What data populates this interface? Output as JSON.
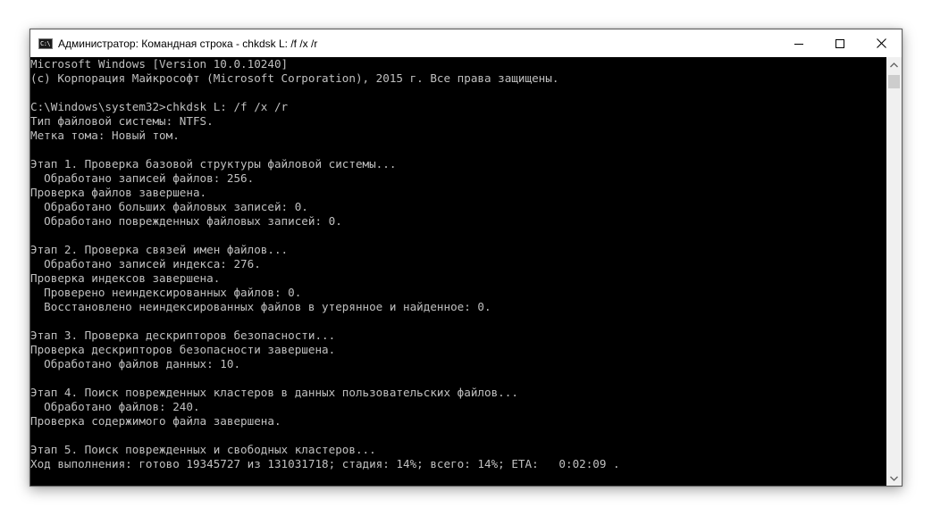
{
  "window": {
    "title": "Администратор: Командная строка - chkdsk  L: /f /x /r",
    "icon_label": "C:\\",
    "icons": {
      "app": "cmd-icon",
      "minimize": "minimize-icon",
      "maximize": "maximize-icon",
      "close": "close-icon",
      "scroll_up": "scroll-up-arrow-icon",
      "scroll_down": "scroll-down-arrow-icon"
    }
  },
  "console": {
    "text_color": "#c0c0c0",
    "background": "#000000",
    "lines": [
      "Microsoft Windows [Version 10.0.10240]",
      "(c) Корпорация Майкрософт (Microsoft Corporation), 2015 г. Все права защищены.",
      "",
      "C:\\Windows\\system32>chkdsk L: /f /x /r",
      "Тип файловой системы: NTFS.",
      "Метка тома: Новый том.",
      "",
      "Этап 1. Проверка базовой структуры файловой системы...",
      "  Обработано записей файлов: 256.",
      "Проверка файлов завершена.",
      "  Обработано больших файловых записей: 0.",
      "  Обработано поврежденных файловых записей: 0.",
      "",
      "Этап 2. Проверка связей имен файлов...",
      "  Обработано записей индекса: 276.",
      "Проверка индексов завершена.",
      "  Проверено неиндексированных файлов: 0.",
      "  Восстановлено неиндексированных файлов в утерянное и найденное: 0.",
      "",
      "Этап 3. Проверка дескрипторов безопасности...",
      "Проверка дескрипторов безопасности завершена.",
      "  Обработано файлов данных: 10.",
      "",
      "Этап 4. Поиск поврежденных кластеров в данных пользовательских файлов...",
      "  Обработано файлов: 240.",
      "Проверка содержимого файла завершена.",
      "",
      "Этап 5. Поиск поврежденных и свободных кластеров...",
      "Ход выполнения: готово 19345727 из 131031718; стадия: 14%; всего: 14%; ETA:   0:02:09 ."
    ]
  }
}
